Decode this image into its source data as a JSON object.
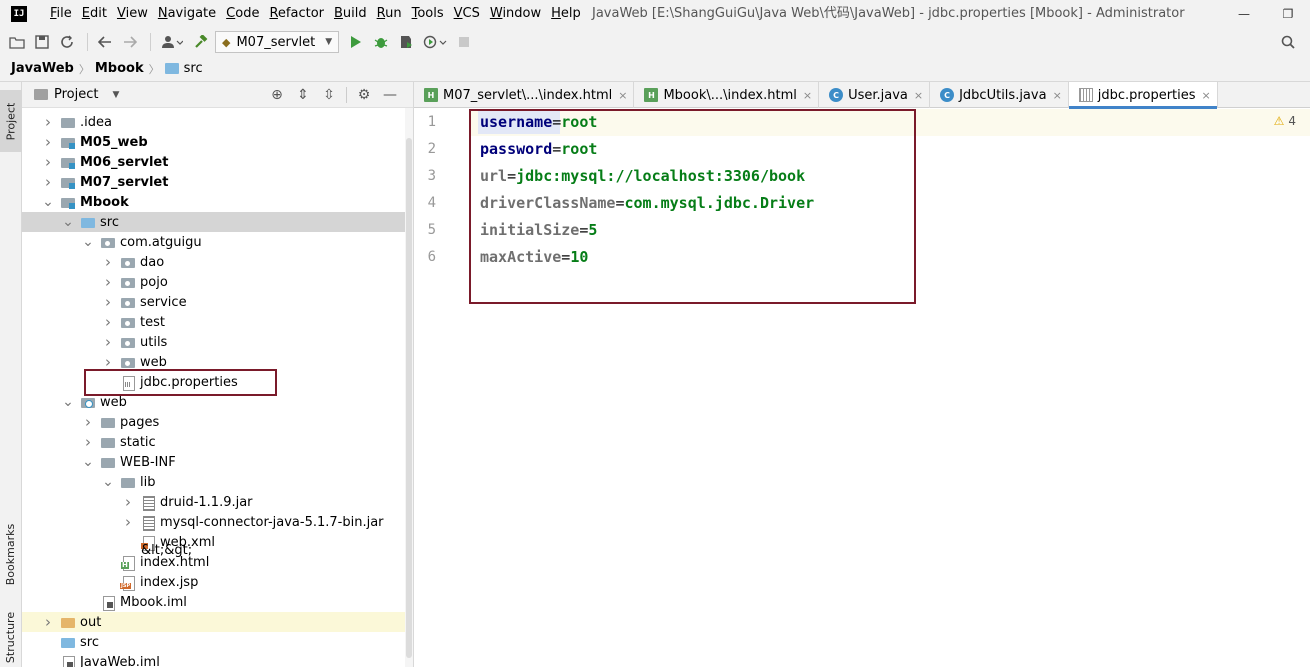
{
  "app": {
    "logo_text": "IJ",
    "window_title": "JavaWeb [E:\\ShangGuiGu\\Java Web\\代码\\JavaWeb] - jdbc.properties [Mbook] - Administrator"
  },
  "menu": [
    "File",
    "Edit",
    "View",
    "Navigate",
    "Code",
    "Refactor",
    "Build",
    "Run",
    "Tools",
    "VCS",
    "Window",
    "Help"
  ],
  "window_controls": {
    "minimize": "—",
    "restore": "❐"
  },
  "toolbar": {
    "run_config": "M07_servlet"
  },
  "breadcrumb": [
    "JavaWeb",
    "Mbook",
    "src"
  ],
  "left_strip": {
    "project": "Project",
    "bookmarks": "Bookmarks",
    "structure": "Structure"
  },
  "project_panel": {
    "title": "Project",
    "tree": [
      {
        "label": ".idea",
        "icon": "folder",
        "indent": 0,
        "chevron": "right",
        "bold": false
      },
      {
        "label": "M05_web",
        "icon": "module",
        "indent": 0,
        "chevron": "right",
        "bold": true
      },
      {
        "label": "M06_servlet",
        "icon": "module",
        "indent": 0,
        "chevron": "right",
        "bold": true
      },
      {
        "label": "M07_servlet",
        "icon": "module",
        "indent": 0,
        "chevron": "right",
        "bold": true
      },
      {
        "label": "Mbook",
        "icon": "module",
        "indent": 0,
        "chevron": "down",
        "bold": true
      },
      {
        "label": "src",
        "icon": "folder-blue",
        "indent": 1,
        "chevron": "down",
        "bold": false,
        "selected": true
      },
      {
        "label": "com.atguigu",
        "icon": "pkg",
        "indent": 2,
        "chevron": "down",
        "bold": false
      },
      {
        "label": "dao",
        "icon": "pkg",
        "indent": 3,
        "chevron": "right",
        "bold": false
      },
      {
        "label": "pojo",
        "icon": "pkg",
        "indent": 3,
        "chevron": "right",
        "bold": false
      },
      {
        "label": "service",
        "icon": "pkg",
        "indent": 3,
        "chevron": "right",
        "bold": false
      },
      {
        "label": "test",
        "icon": "pkg",
        "indent": 3,
        "chevron": "right",
        "bold": false
      },
      {
        "label": "utils",
        "icon": "pkg",
        "indent": 3,
        "chevron": "right",
        "bold": false
      },
      {
        "label": "web",
        "icon": "pkg",
        "indent": 3,
        "chevron": "right",
        "bold": false
      },
      {
        "label": "jdbc.properties",
        "icon": "props",
        "indent": 3,
        "chevron": "none",
        "bold": false
      },
      {
        "label": "web",
        "icon": "web",
        "indent": 1,
        "chevron": "down",
        "bold": false
      },
      {
        "label": "pages",
        "icon": "folder",
        "indent": 2,
        "chevron": "right",
        "bold": false
      },
      {
        "label": "static",
        "icon": "folder",
        "indent": 2,
        "chevron": "right",
        "bold": false
      },
      {
        "label": "WEB-INF",
        "icon": "folder",
        "indent": 2,
        "chevron": "down",
        "bold": false
      },
      {
        "label": "lib",
        "icon": "folder",
        "indent": 3,
        "chevron": "down",
        "bold": false
      },
      {
        "label": "druid-1.1.9.jar",
        "icon": "jar",
        "indent": 4,
        "chevron": "right",
        "bold": false
      },
      {
        "label": "mysql-connector-java-5.1.7-bin.jar",
        "icon": "jar",
        "indent": 4,
        "chevron": "right",
        "bold": false
      },
      {
        "label": "web.xml",
        "icon": "xml",
        "indent": 4,
        "chevron": "none",
        "bold": false
      },
      {
        "label": "index.html",
        "icon": "html",
        "indent": 3,
        "chevron": "none",
        "bold": false
      },
      {
        "label": "index.jsp",
        "icon": "jsp",
        "indent": 3,
        "chevron": "none",
        "bold": false
      },
      {
        "label": "Mbook.iml",
        "icon": "iml",
        "indent": 2,
        "chevron": "none",
        "bold": false
      },
      {
        "label": "out",
        "icon": "folder-orange",
        "indent": 0,
        "chevron": "right",
        "bold": false,
        "highlight": true
      },
      {
        "label": "src",
        "icon": "folder-blue",
        "indent": 0,
        "chevron": "none",
        "bold": false
      },
      {
        "label": "JavaWeb.iml",
        "icon": "iml",
        "indent": 0,
        "chevron": "none",
        "bold": false
      }
    ]
  },
  "editor_tabs": [
    {
      "label": "M07_servlet\\...\\index.html",
      "icon": "html",
      "active": false
    },
    {
      "label": "Mbook\\...\\index.html",
      "icon": "html",
      "active": false
    },
    {
      "label": "User.java",
      "icon": "java",
      "active": false
    },
    {
      "label": "JdbcUtils.java",
      "icon": "java",
      "active": false
    },
    {
      "label": "jdbc.properties",
      "icon": "props",
      "active": true
    }
  ],
  "editor": {
    "warning_count": "4",
    "lines": [
      {
        "number": "1",
        "key": "username",
        "value": "root",
        "key_style": "key"
      },
      {
        "number": "2",
        "key": "password",
        "value": "root",
        "key_style": "key"
      },
      {
        "number": "3",
        "key": "url",
        "value": "jdbc:mysql://localhost:3306/book",
        "key_style": "dim"
      },
      {
        "number": "4",
        "key": "driverClassName",
        "value": "com.mysql.jdbc.Driver",
        "key_style": "dim"
      },
      {
        "number": "5",
        "key": "initialSize",
        "value": "5",
        "key_style": "dim"
      },
      {
        "number": "6",
        "key": "maxActive",
        "value": "10",
        "key_style": "dim"
      }
    ]
  },
  "colors": {
    "accent": "#4083c9",
    "annotation_box": "#7a1a2a",
    "value_green": "#067d17",
    "key_navy": "#00007a"
  }
}
